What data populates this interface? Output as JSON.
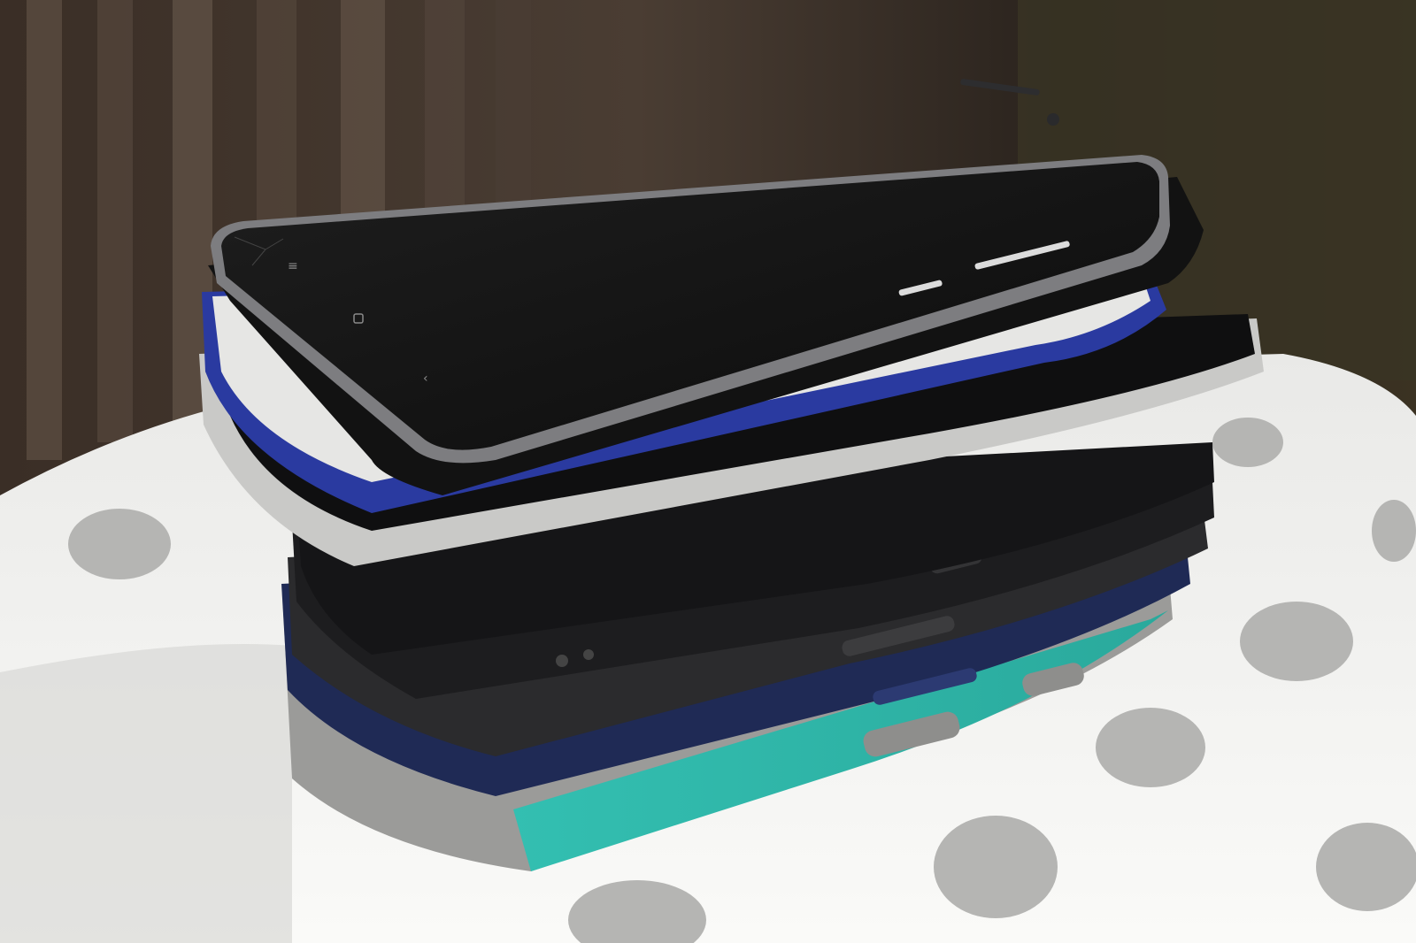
{
  "image": {
    "kind": "photograph",
    "subject_tag": "stacked-smartphones",
    "phone_count": 9,
    "colors": {
      "background_dark": "#1a1410",
      "bench_white": "#f2f2f0",
      "polka_dot_grey": "#b8b8b6",
      "phone_black": "#151515",
      "phone_graphite": "#2a2a2c",
      "case_navy": "#1f2a55",
      "case_royal_blue": "#2a3aa0",
      "case_teal": "#35c2b4",
      "case_grey": "#9a9a98",
      "silver_frame": "#c9c9c7"
    }
  }
}
